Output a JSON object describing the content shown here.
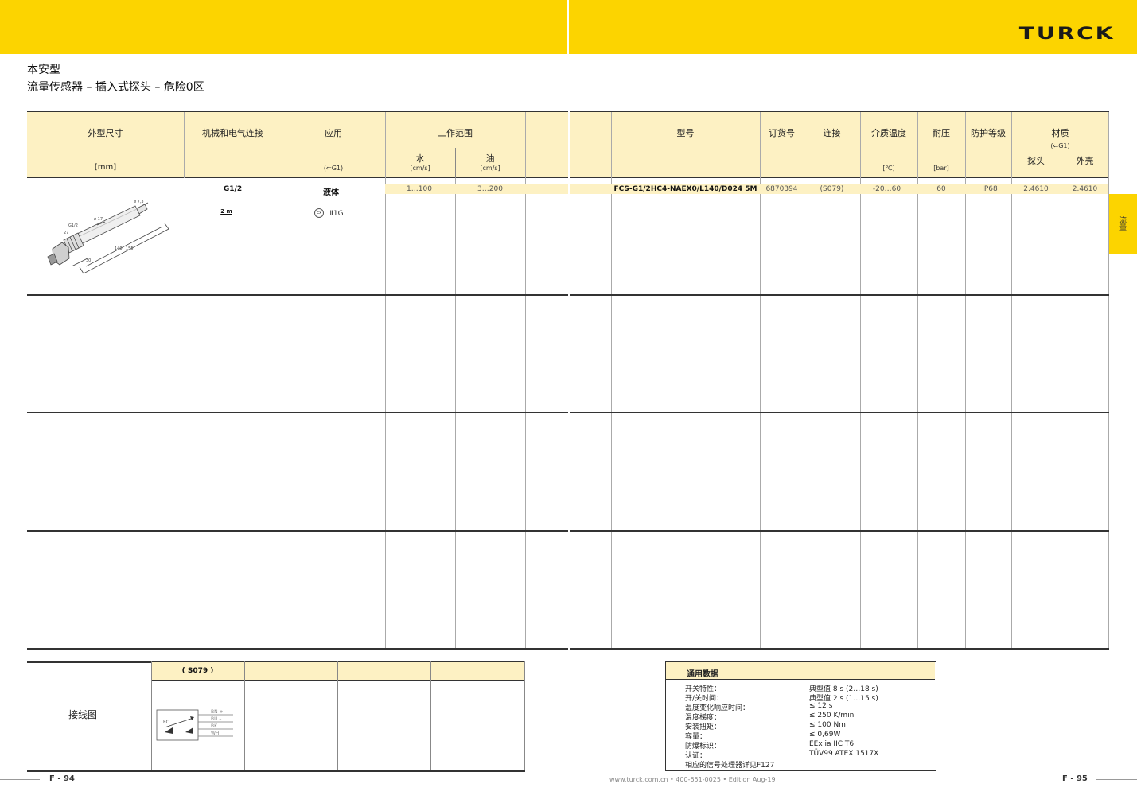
{
  "brand": {
    "logo": "TURCK",
    "color": "#fcd400"
  },
  "title": {
    "line1": "本安型",
    "line2": "流量传感器 – 插入式探头 – 危险0区"
  },
  "left_header": {
    "dimension": "外型尺寸",
    "dimension_unit": "[mm]",
    "connection": "机械和电气连接",
    "application": "应用",
    "application_note": "(⇐G1)",
    "operating_range": "工作范围",
    "water": "水",
    "water_unit": "[cm/s]",
    "oil": "油",
    "oil_unit": "[cm/s]"
  },
  "right_header": {
    "type": "型号",
    "order_no": "订货号",
    "connection": "连接",
    "medium_temp": "介质温度",
    "medium_temp_unit": "[℃]",
    "pressure": "耐压",
    "pressure_unit": "[bar]",
    "protection": "防护等级",
    "material": "材质",
    "material_note": "(⇐G1)",
    "probe": "探头",
    "housing": "外壳"
  },
  "row": {
    "thread": "G1/2",
    "cable": "2 m",
    "medium": "液体",
    "atex": "Ⅱ1G",
    "ex_mark": "Ex",
    "water_range": "1…100",
    "oil_range": "3…200",
    "type": "FCS-G1/2HC4-NAEX0/L140/D024 5M",
    "order_no": "6870394",
    "connection": "(S079)",
    "temp": "-20…60",
    "pressure": "60",
    "protection": "IP68",
    "probe_mat": "2.4610",
    "housing_mat": "2.4610"
  },
  "drawing": {
    "d1": "ø 7,3",
    "d2": "ø 17",
    "thread": "G1/2",
    "sw": "27",
    "l1": "140",
    "l2": "155",
    "l3": "30"
  },
  "side_tab": "流量",
  "wiring": {
    "label": "接线图",
    "code": "( S079 )",
    "device": "FC",
    "wires": [
      "BN +",
      "BU –",
      "BK",
      "WH"
    ]
  },
  "general": {
    "title": "通用数据",
    "rows": [
      {
        "k": "开关特性：",
        "v": "典型值 8 s (2…18 s)"
      },
      {
        "k": "开/关时间：",
        "v": "典型值 2 s (1…15 s)"
      },
      {
        "k": "温度变化响应时间：",
        "v": "≤ 12 s"
      },
      {
        "k": "温度梯度：",
        "v": "≤ 250 K/min"
      },
      {
        "k": "安装扭矩：",
        "v": "≤ 100 Nm"
      },
      {
        "k": "容量：",
        "v": "≤ 0,69W"
      },
      {
        "k": "防爆标识：",
        "v": "EEx ia IIC T6"
      },
      {
        "k": "认证：",
        "v": "TÜV99 ATEX 1517X"
      },
      {
        "k": "相应的信号处理器详见F127",
        "v": ""
      }
    ]
  },
  "footer": {
    "left_page": "F - 94",
    "center": "www.turck.com.cn • 400-651-0025 • Edition Aug-19",
    "right_page": "F - 95"
  }
}
